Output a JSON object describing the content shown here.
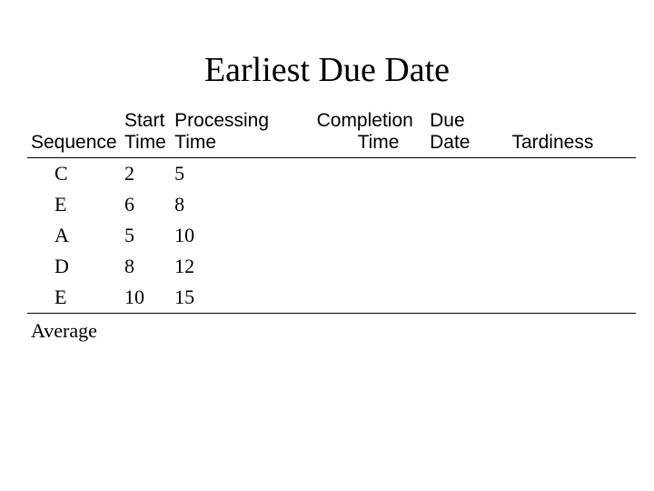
{
  "title": "Earliest Due Date",
  "headers": {
    "sequence": "Sequence",
    "start_time_l1": "Start",
    "start_time_l2": "Time",
    "processing_l1": "Processing",
    "processing_l2": "Time",
    "completion_l1": "Completion",
    "completion_l2": "Time",
    "due_l1": "Due",
    "due_l2": "Date",
    "tardiness": "Tardiness"
  },
  "rows": [
    {
      "sequence": "C",
      "start": "2",
      "processing": "5",
      "completion": "",
      "due": "",
      "tardiness": ""
    },
    {
      "sequence": "E",
      "start": "6",
      "processing": "8",
      "completion": "",
      "due": "",
      "tardiness": ""
    },
    {
      "sequence": "A",
      "start": "5",
      "processing": "10",
      "completion": "",
      "due": "",
      "tardiness": ""
    },
    {
      "sequence": "D",
      "start": "8",
      "processing": "12",
      "completion": "",
      "due": "",
      "tardiness": ""
    },
    {
      "sequence": "E",
      "start": "10",
      "processing": "15",
      "completion": "",
      "due": "",
      "tardiness": ""
    }
  ],
  "footer": {
    "average_label": "Average"
  },
  "chart_data": {
    "type": "table",
    "title": "Earliest Due Date",
    "columns": [
      "Sequence",
      "Start Time",
      "Processing Time",
      "Completion Time",
      "Due Date",
      "Tardiness"
    ],
    "rows": [
      [
        "C",
        2,
        5,
        null,
        null,
        null
      ],
      [
        "E",
        6,
        8,
        null,
        null,
        null
      ],
      [
        "A",
        5,
        10,
        null,
        null,
        null
      ],
      [
        "D",
        8,
        12,
        null,
        null,
        null
      ],
      [
        "E",
        10,
        15,
        null,
        null,
        null
      ]
    ],
    "footer": [
      "Average",
      null,
      null,
      null,
      null,
      null
    ]
  }
}
